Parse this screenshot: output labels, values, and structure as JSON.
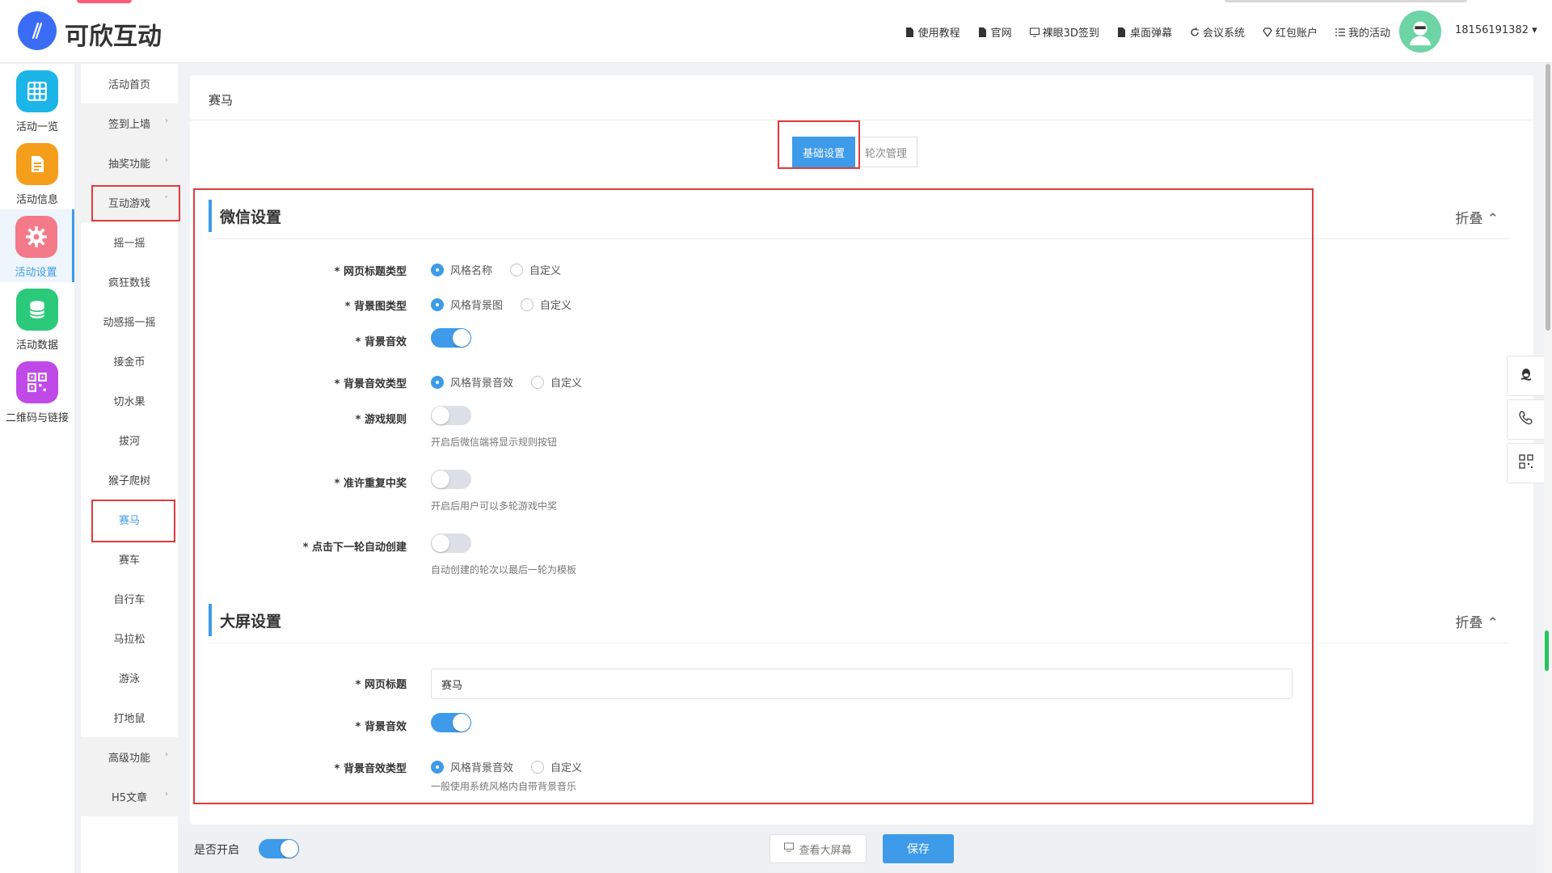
{
  "header": {
    "logo_text": "可欣互动",
    "nav": [
      "使用教程",
      "官网",
      "裸眼3D签到",
      "桌面弹幕",
      "会议系统",
      "红包账户",
      "我的活动"
    ],
    "username": "18156191382 ▾"
  },
  "iconbar": {
    "items": [
      {
        "label": "活动一览",
        "color": "#1cb5e8",
        "icon": "grid-icon"
      },
      {
        "label": "活动信息",
        "color": "#f59e1c",
        "icon": "document-icon"
      },
      {
        "label": "活动设置",
        "color": "#f47a8a",
        "icon": "gear-icon",
        "active": true
      },
      {
        "label": "活动数据",
        "color": "#2bc97a",
        "icon": "database-icon"
      },
      {
        "label": "二维码与链接",
        "color": "#c04ae8",
        "icon": "qrcode-icon"
      }
    ]
  },
  "submenu": {
    "items": [
      {
        "label": "活动首页",
        "group": false
      },
      {
        "label": "签到上墙",
        "group": true,
        "chev": "›"
      },
      {
        "label": "抽奖功能",
        "group": true,
        "chev": "›"
      },
      {
        "label": "互动游戏",
        "group": true,
        "chev": "˅"
      },
      {
        "label": "摇一摇",
        "group": false
      },
      {
        "label": "疯狂数钱",
        "group": false
      },
      {
        "label": "动感摇一摇",
        "group": false
      },
      {
        "label": "接金币",
        "group": false
      },
      {
        "label": "切水果",
        "group": false
      },
      {
        "label": "拔河",
        "group": false
      },
      {
        "label": "猴子爬树",
        "group": false
      },
      {
        "label": "赛马",
        "group": false,
        "active": true
      },
      {
        "label": "赛车",
        "group": false
      },
      {
        "label": "自行车",
        "group": false
      },
      {
        "label": "马拉松",
        "group": false
      },
      {
        "label": "游泳",
        "group": false
      },
      {
        "label": "打地鼠",
        "group": false
      },
      {
        "label": "高级功能",
        "group": true,
        "chev": "›"
      },
      {
        "label": "H5文章",
        "group": true,
        "chev": "›"
      }
    ]
  },
  "panel": {
    "title": "赛马",
    "tabs": {
      "basic": "基础设置",
      "rounds": "轮次管理"
    },
    "wechat": {
      "heading": "微信设置",
      "fold": "折叠",
      "title_type_label": "* 网页标题类型",
      "title_type_opt1": "风格名称",
      "title_type_opt2": "自定义",
      "bg_type_label": "* 背景图类型",
      "bg_type_opt1": "风格背景图",
      "bg_type_opt2": "自定义",
      "bg_sound_label": "* 背景音效",
      "bg_sound_type_label": "* 背景音效类型",
      "bg_sound_type_opt1": "风格背景音效",
      "bg_sound_type_opt2": "自定义",
      "rules_label": "* 游戏规则",
      "rules_hint": "开启后微信端将显示规则按钮",
      "repeat_label": "* 准许重复中奖",
      "repeat_hint": "开启后用户可以多轮游戏中奖",
      "autocreate_label": "* 点击下一轮自动创建",
      "autocreate_hint": "自动创建的轮次以最后一轮为模板"
    },
    "screen": {
      "heading": "大屏设置",
      "fold": "折叠",
      "page_title_label": "* 网页标题",
      "page_title_value": "赛马",
      "bg_sound_label": "* 背景音效",
      "bg_sound_type_label": "* 背景音效类型",
      "bg_sound_type_opt1": "风格背景音效",
      "bg_sound_type_opt2": "自定义",
      "bg_sound_hint": "一般使用系统风格内自带背景音乐"
    }
  },
  "bottombar": {
    "enable_label": "是否开启",
    "view_button": "查看大屏幕",
    "save_button": "保存"
  },
  "colors": {
    "accent": "#3d9be9",
    "highlight_box": "#e03c3c"
  }
}
